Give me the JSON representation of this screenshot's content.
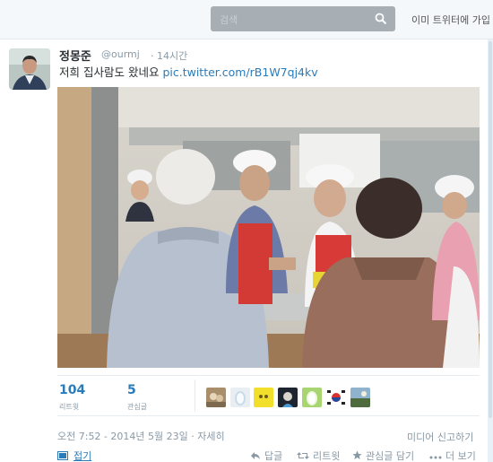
{
  "search": {
    "placeholder": "검색"
  },
  "topbar": {
    "already_member": "이미 트위터에 가입"
  },
  "tweet": {
    "name": "정몽준",
    "handle": "@ourmj",
    "separator": "·",
    "time": "14시간",
    "text": "저희 집사람도 왔네요",
    "link": "pic.twitter.com/rB1W7qj4kv",
    "retweets": {
      "count": "104",
      "label": "리트윗"
    },
    "favorites": {
      "count": "5",
      "label": "관심글"
    },
    "datetime": "오전 7:52 - 2014년 5월 23일 · 자세히",
    "report": "미디어 신고하기"
  },
  "actions": {
    "collapse": "접기",
    "reply": "답글",
    "retweet": "리트윗",
    "favorite": "관심글 담기",
    "more": "더 보기"
  },
  "colors": {
    "link": "#2b7bb9",
    "muted": "#8899a6",
    "text": "#292f33"
  }
}
